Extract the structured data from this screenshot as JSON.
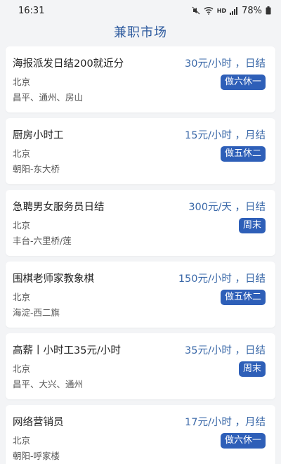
{
  "status_bar": {
    "time": "16:31",
    "battery_percent": "78%",
    "network_label": "HD"
  },
  "header": {
    "title": "兼职市场"
  },
  "jobs": [
    {
      "title": "海报派发日结200就近分",
      "salary": "30元/小时 ，日结",
      "city": "北京",
      "district": "昌平、通州、房山",
      "schedule": "做六休一"
    },
    {
      "title": "厨房小时工",
      "salary": "15元/小时 ，月结",
      "city": "北京",
      "district": "朝阳-东大桥",
      "schedule": "做五休二"
    },
    {
      "title": "急聘男女服务员日结",
      "salary": "300元/天 ，日结",
      "city": "北京",
      "district": "丰台-六里桥/莲",
      "schedule": "周末"
    },
    {
      "title": "围棋老师家教象棋",
      "salary": "150元/小时 ，日结",
      "city": "北京",
      "district": "海淀-西二旗",
      "schedule": "做五休二"
    },
    {
      "title": "高薪丨小时工35元/小时",
      "salary": "35元/小时 ，日结",
      "city": "北京",
      "district": "昌平、大兴、通州",
      "schedule": "周末"
    },
    {
      "title": "网络营销员",
      "salary": "17元/小时 ，月结",
      "city": "北京",
      "district": "朝阳-呼家楼",
      "schedule": "做六休一"
    }
  ],
  "colors": {
    "accent": "#2e5fb8",
    "salary": "#3a68a8",
    "title": "#2d5a9e",
    "background": "#f3f4f6"
  }
}
